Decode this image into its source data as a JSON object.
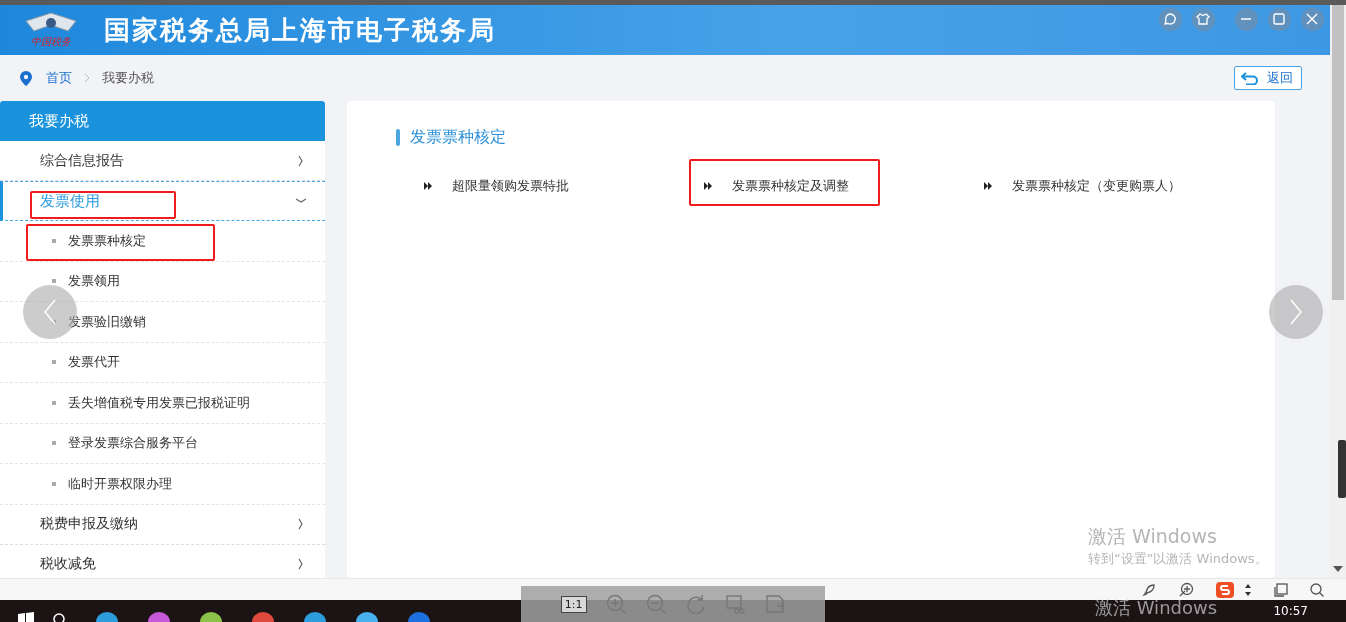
{
  "header": {
    "logo_text": "中国税务",
    "title": "国家税务总局上海市电子税务局"
  },
  "breadcrumb": {
    "items": [
      "首页",
      "我要办税"
    ],
    "back_button": "返回"
  },
  "sidebar": {
    "title": "我要办税",
    "groups": [
      {
        "label": "综合信息报告",
        "expanded": false,
        "selected": false,
        "highlighted": false
      },
      {
        "label": "发票使用",
        "expanded": true,
        "selected": true,
        "highlighted": true,
        "children": [
          {
            "label": "发票票种核定",
            "highlighted": true
          },
          {
            "label": "发票领用",
            "highlighted": false
          },
          {
            "label": "发票验旧缴销",
            "highlighted": false
          },
          {
            "label": "发票代开",
            "highlighted": false
          },
          {
            "label": "丢失增值税专用发票已报税证明",
            "highlighted": false
          },
          {
            "label": "登录发票综合服务平台",
            "highlighted": false
          },
          {
            "label": "临时开票权限办理",
            "highlighted": false
          }
        ]
      },
      {
        "label": "税费申报及缴纳",
        "expanded": false,
        "selected": false,
        "highlighted": false
      },
      {
        "label": "税收减免",
        "expanded": false,
        "selected": false,
        "highlighted": false
      }
    ]
  },
  "panel": {
    "title": "发票票种核定",
    "links": [
      {
        "label": "超限量领购发票特批",
        "highlighted": false
      },
      {
        "label": "发票票种核定及调整",
        "highlighted": true
      },
      {
        "label": "发票票种核定（变更购票人）",
        "highlighted": false
      }
    ]
  },
  "viewer": {
    "zoom_label": "1:1"
  },
  "watermark": {
    "title": "激活 Windows",
    "subtitle": "转到“设置”以激活 Windows。",
    "repeat": "激活 Windows"
  },
  "taskbar": {
    "clock": "10:57"
  }
}
